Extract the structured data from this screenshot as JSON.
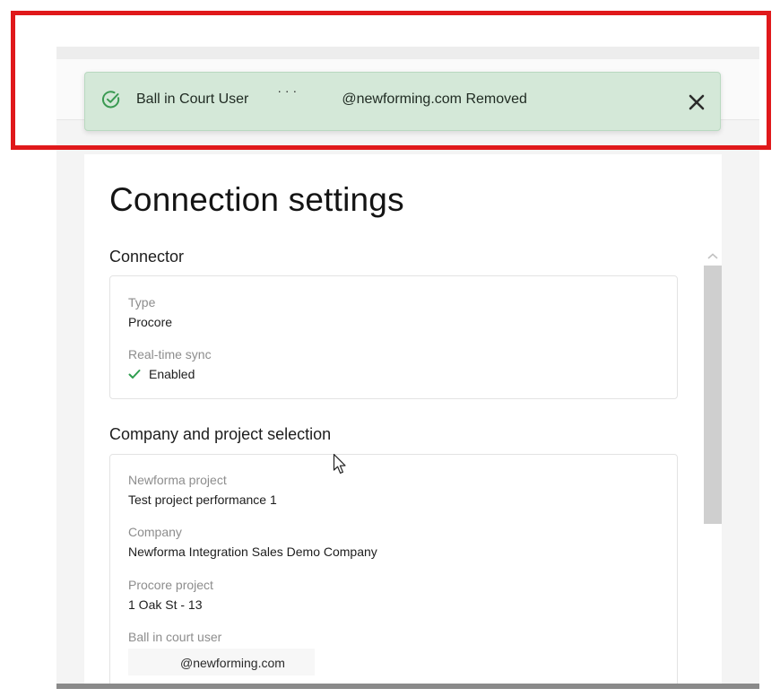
{
  "toast": {
    "message_prefix": "Ball in Court User",
    "message_suffix": "@newforming.com Removed",
    "status": "success",
    "accent_color": "#3a9a52"
  },
  "page": {
    "title": "Connection settings"
  },
  "connector": {
    "section_title": "Connector",
    "type_label": "Type",
    "type_value": "Procore",
    "sync_label": "Real-time sync",
    "sync_value": "Enabled"
  },
  "selection": {
    "section_title": "Company and project selection",
    "newforma_project_label": "Newforma project",
    "newforma_project_value": "Test project performance 1",
    "company_label": "Company",
    "company_value": "Newforma Integration Sales Demo Company",
    "procore_project_label": "Procore project",
    "procore_project_value": "1 Oak St - 13",
    "ball_in_court_label": "Ball in court user",
    "ball_in_court_value": "@newforming.com"
  },
  "icons": {
    "toast_icon": "check-circle-icon",
    "close_icon": "close-icon",
    "enabled_icon": "checkmark-icon",
    "scroll_icon": "chevron-up-icon"
  }
}
